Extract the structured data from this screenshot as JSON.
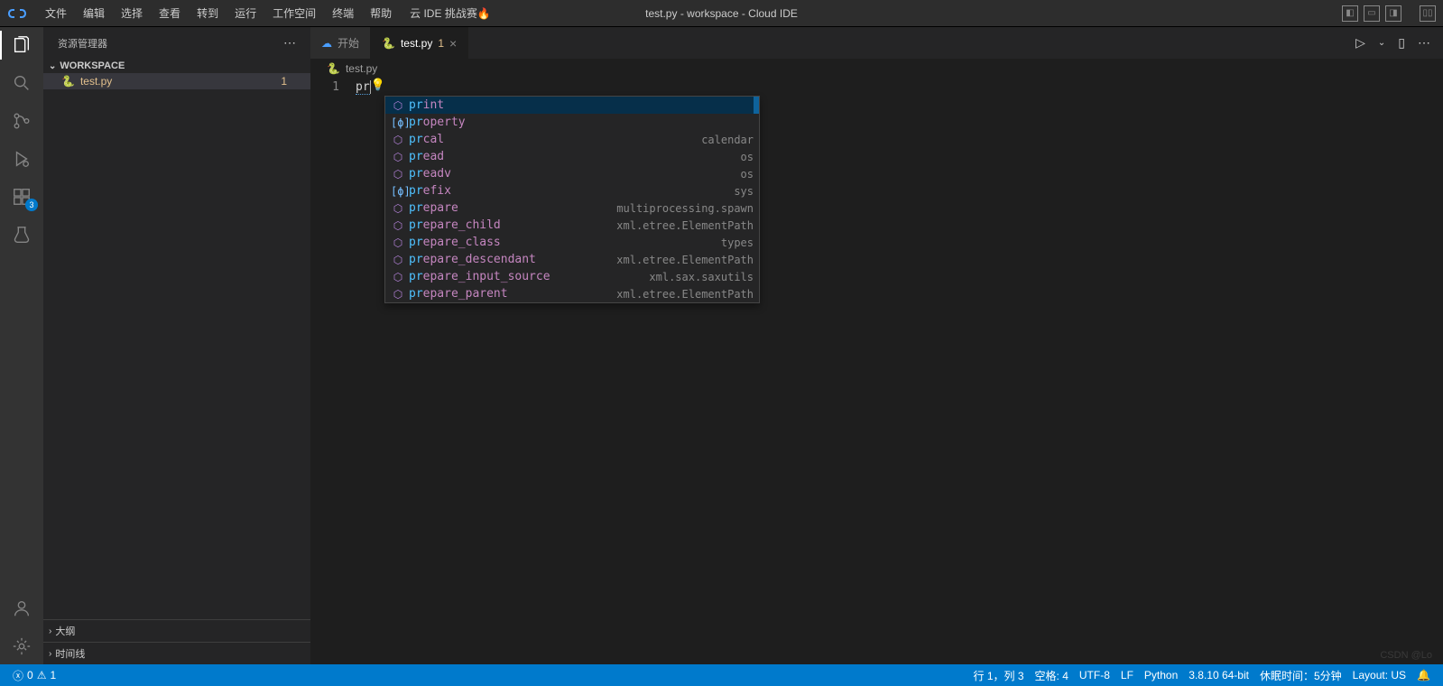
{
  "titlebar": {
    "menus": [
      "文件",
      "编辑",
      "选择",
      "查看",
      "转到",
      "运行",
      "工作空间",
      "终端",
      "帮助"
    ],
    "challenge": "云 IDE 挑战赛🔥",
    "title": "test.py - workspace - Cloud IDE"
  },
  "activity": {
    "ext_badge": "3"
  },
  "sidebar": {
    "title": "资源管理器",
    "workspace": "WORKSPACE",
    "file": {
      "name": "test.py",
      "num": "1"
    },
    "outline": "大纲",
    "timeline": "时间线"
  },
  "tabs": {
    "start": "开始",
    "file": "test.py",
    "mod": "1"
  },
  "breadcrumb": {
    "file": "test.py"
  },
  "editor": {
    "line_no": "1",
    "typed": "pr"
  },
  "suggest": [
    {
      "kind": "fn",
      "match": "pr",
      "rest": "int",
      "detail": "",
      "sel": true
    },
    {
      "kind": "var",
      "match": "pr",
      "rest": "operty",
      "detail": ""
    },
    {
      "kind": "fn",
      "match": "pr",
      "rest": "cal",
      "detail": "calendar"
    },
    {
      "kind": "fn",
      "match": "pr",
      "rest": "ead",
      "detail": "os"
    },
    {
      "kind": "fn",
      "match": "pr",
      "rest": "eadv",
      "detail": "os"
    },
    {
      "kind": "var",
      "match": "pr",
      "rest": "efix",
      "detail": "sys"
    },
    {
      "kind": "fn",
      "match": "pr",
      "rest": "epare",
      "detail": "multiprocessing.spawn"
    },
    {
      "kind": "fn",
      "match": "pr",
      "rest": "epare_child",
      "detail": "xml.etree.ElementPath"
    },
    {
      "kind": "fn",
      "match": "pr",
      "rest": "epare_class",
      "detail": "types"
    },
    {
      "kind": "fn",
      "match": "pr",
      "rest": "epare_descendant",
      "detail": "xml.etree.ElementPath"
    },
    {
      "kind": "fn",
      "match": "pr",
      "rest": "epare_input_source",
      "detail": "xml.sax.saxutils"
    },
    {
      "kind": "fn",
      "match": "pr",
      "rest": "epare_parent",
      "detail": "xml.etree.ElementPath"
    }
  ],
  "status": {
    "errors": "0",
    "warnings": "1",
    "pos": "行 1，列 3",
    "spaces": "空格: 4",
    "encoding": "UTF-8",
    "eol": "LF",
    "lang": "Python",
    "version": "3.8.10 64-bit",
    "sleep": "休眠时间：5分钟",
    "layout": "Layout: US"
  },
  "watermark": "CSDN @Lo"
}
